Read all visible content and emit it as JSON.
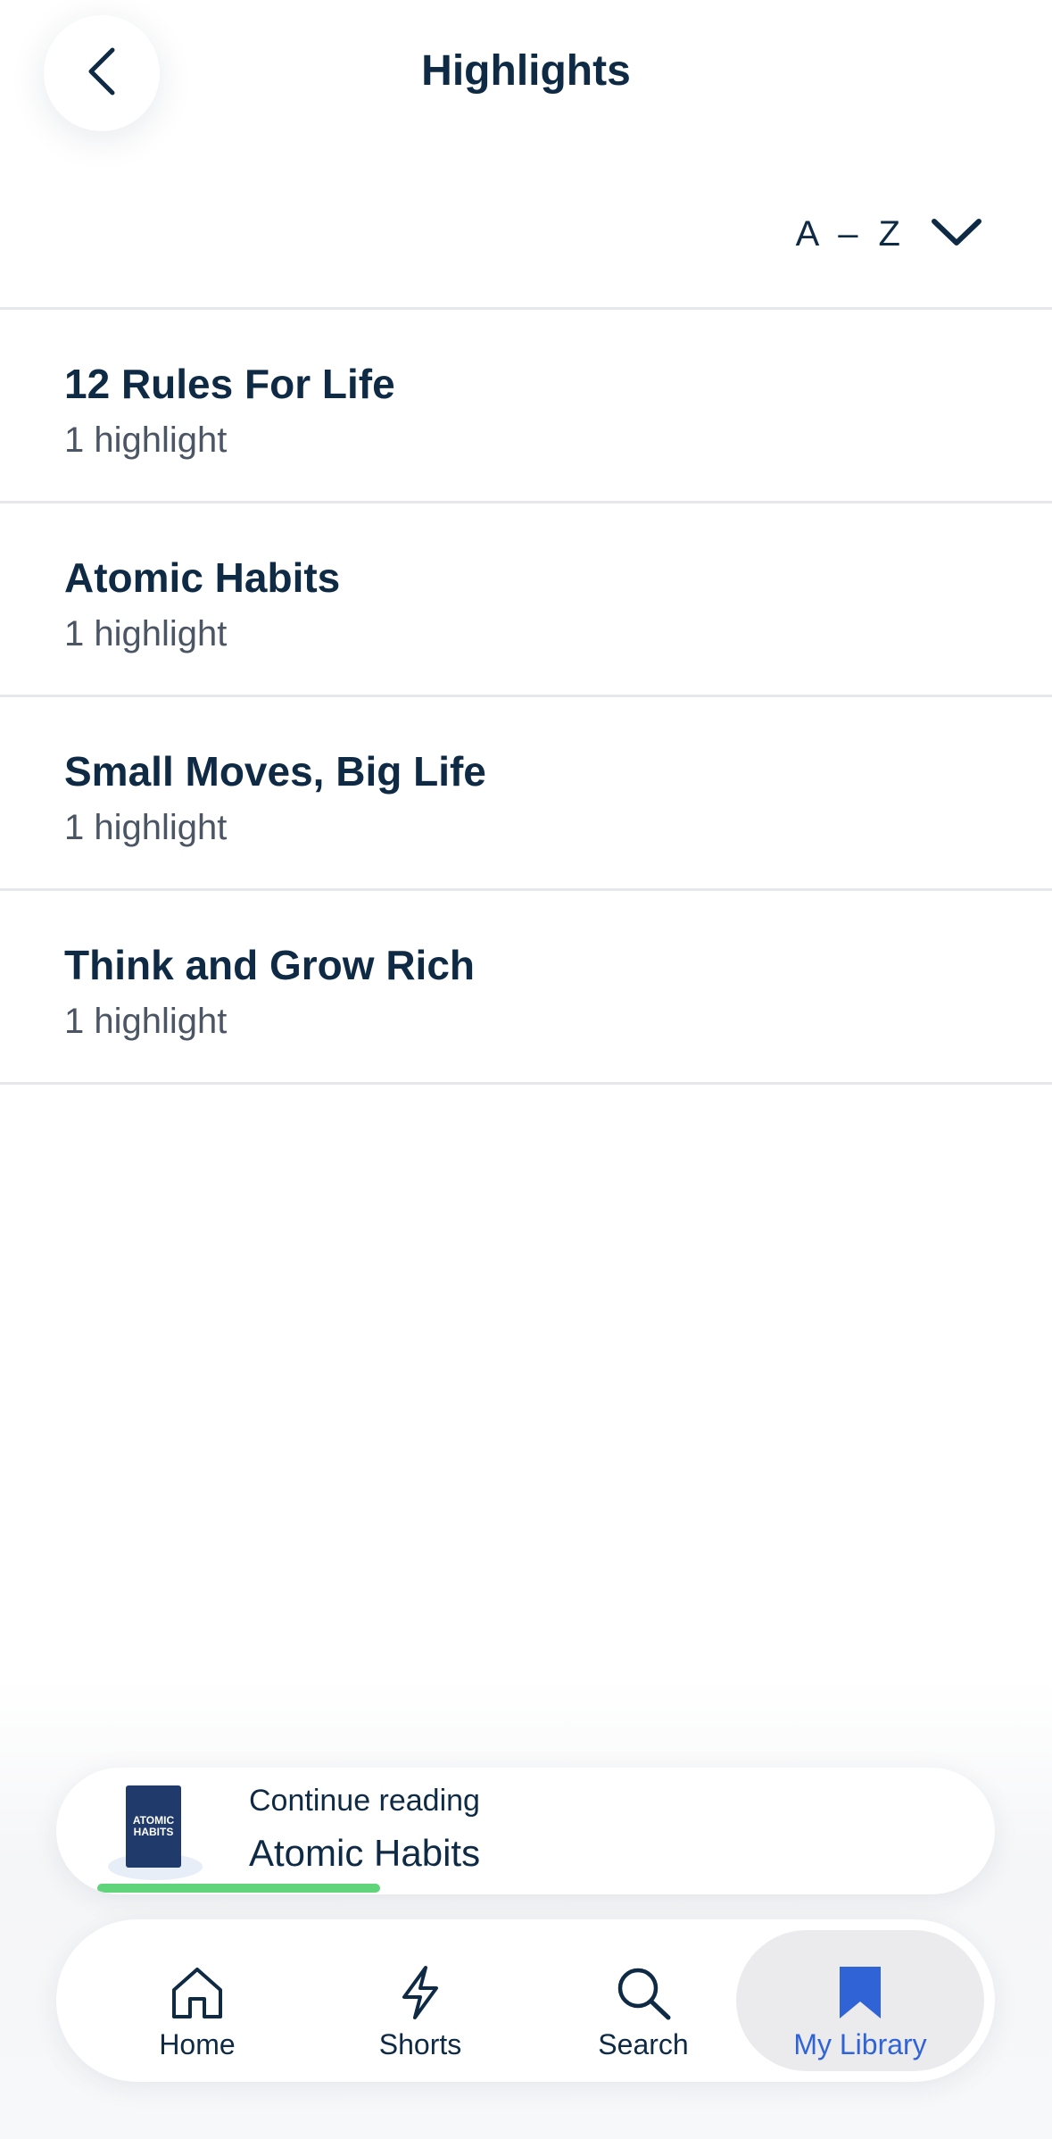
{
  "header": {
    "title": "Highlights",
    "back_icon": "chevron-left-icon"
  },
  "sort": {
    "label": "A – Z",
    "icon": "chevron-down-icon"
  },
  "highlights": [
    {
      "title": "12 Rules For Life",
      "count": "1 highlight"
    },
    {
      "title": "Atomic Habits",
      "count": "1 highlight"
    },
    {
      "title": "Small Moves, Big Life",
      "count": "1 highlight"
    },
    {
      "title": "Think and Grow Rich",
      "count": "1 highlight"
    }
  ],
  "continue_reading": {
    "label": "Continue reading",
    "book_title": "Atomic Habits",
    "cover_text": "ATOMIC HABITS",
    "progress": 0.33,
    "progress_color": "#5fd47a"
  },
  "tabbar": {
    "active_color": "#2f63d6",
    "items": [
      {
        "label": "Home",
        "icon": "home-icon"
      },
      {
        "label": "Shorts",
        "icon": "lightning-icon"
      },
      {
        "label": "Search",
        "icon": "search-icon"
      },
      {
        "label": "My Library",
        "icon": "bookmark-icon",
        "active": true
      }
    ]
  }
}
